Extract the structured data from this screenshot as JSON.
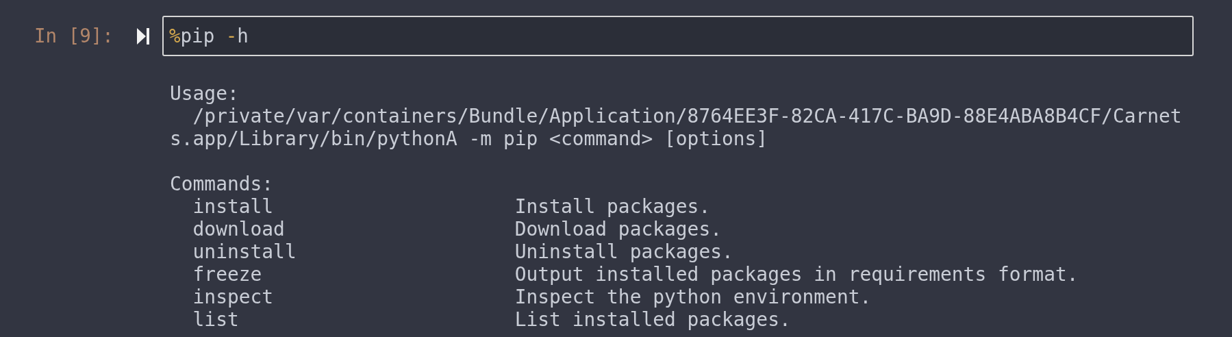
{
  "cell": {
    "prompt": "In [9]:",
    "input_tokens": [
      {
        "text": "%",
        "kind": "magic"
      },
      {
        "text": "pip ",
        "kind": "plain"
      },
      {
        "text": "-",
        "kind": "operator"
      },
      {
        "text": "h",
        "kind": "plain"
      }
    ]
  },
  "output": {
    "usage_heading": "Usage:",
    "usage_lines": [
      "  /private/var/containers/Bundle/Application/8764EE3F-82CA-417C-BA9D-88E4ABA8B4CF/Carnet",
      "s.app/Library/bin/pythonA -m pip <command> [options]"
    ],
    "commands_heading": "Commands:",
    "commands": [
      {
        "name": "install",
        "description": "Install packages."
      },
      {
        "name": "download",
        "description": "Download packages."
      },
      {
        "name": "uninstall",
        "description": "Uninstall packages."
      },
      {
        "name": "freeze",
        "description": "Output installed packages in requirements format."
      },
      {
        "name": "inspect",
        "description": "Inspect the python environment."
      },
      {
        "name": "list",
        "description": "List installed packages."
      }
    ]
  }
}
